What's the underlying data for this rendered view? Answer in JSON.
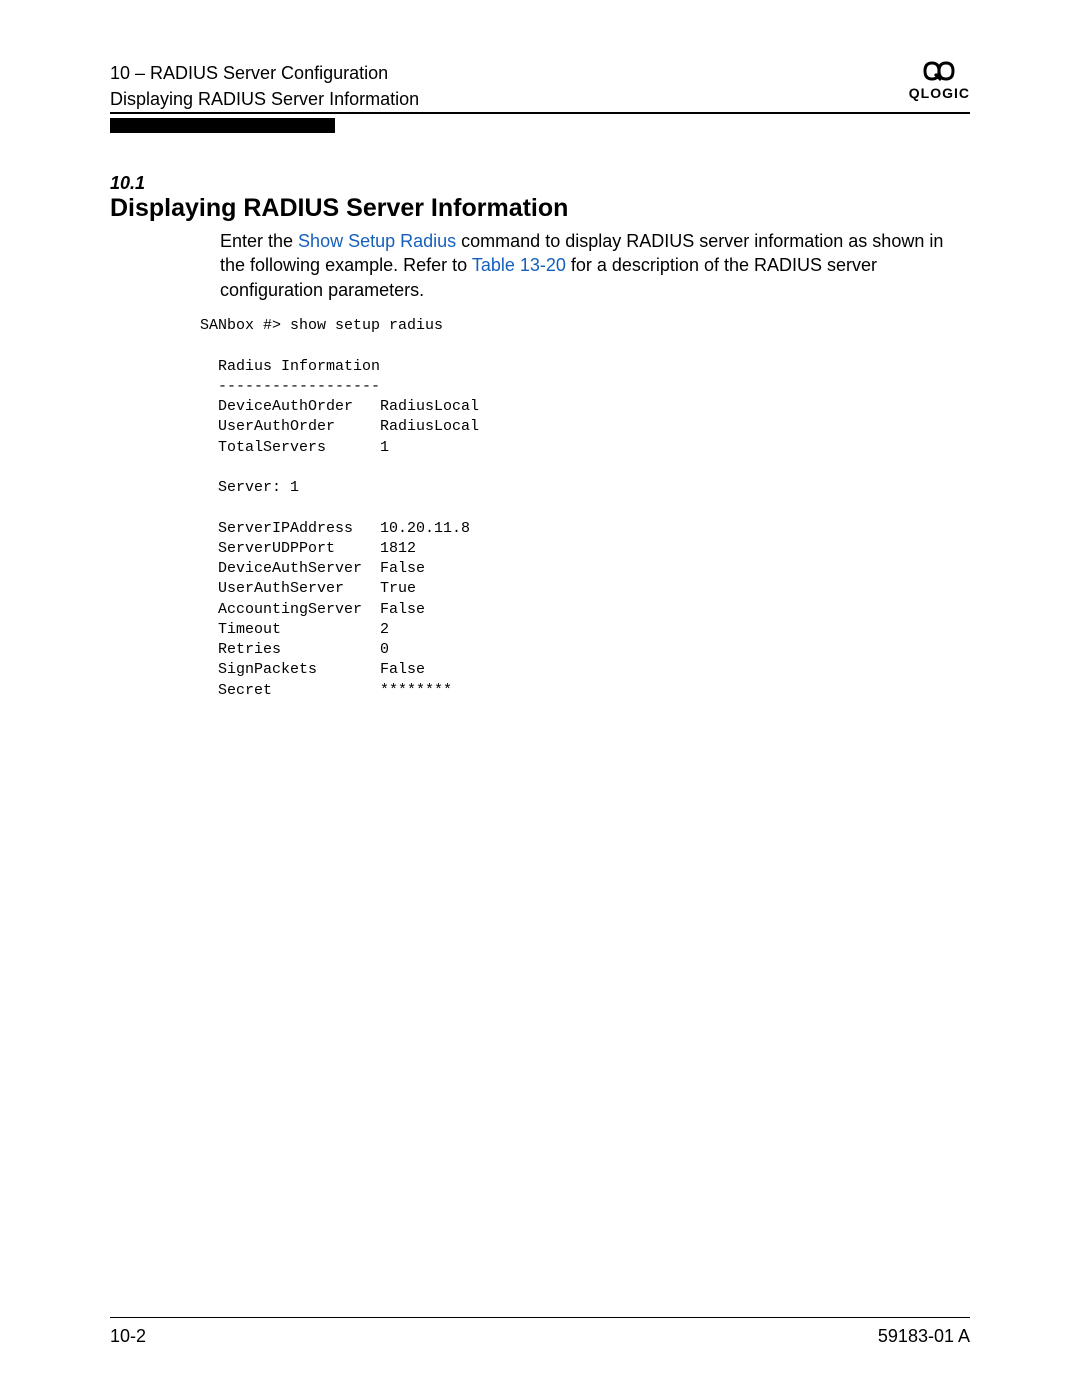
{
  "header": {
    "line1": "10 – RADIUS Server Configuration",
    "line2": "Displaying RADIUS Server Information",
    "logo_text": "QLOGIC"
  },
  "section": {
    "number": "10.1",
    "title": "Displaying RADIUS Server Information"
  },
  "body": {
    "p1_part1": "Enter the ",
    "p1_link1": "Show Setup Radius",
    "p1_part2": " command to display RADIUS server information as shown in the following example. Refer to ",
    "p1_link2": "Table 13-20",
    "p1_part3": " for a description of the RADIUS server configuration parameters."
  },
  "code": {
    "prompt": "SANbox #> show setup radius",
    "heading": "  Radius Information",
    "divider": "  ------------------",
    "rows1": [
      {
        "k": "  DeviceAuthOrder",
        "v": "RadiusLocal"
      },
      {
        "k": "  UserAuthOrder",
        "v": "RadiusLocal"
      },
      {
        "k": "  TotalServers",
        "v": "1"
      }
    ],
    "server_line": "  Server: 1",
    "rows2": [
      {
        "k": "  ServerIPAddress",
        "v": "10.20.11.8"
      },
      {
        "k": "  ServerUDPPort",
        "v": "1812"
      },
      {
        "k": "  DeviceAuthServer",
        "v": "False"
      },
      {
        "k": "  UserAuthServer",
        "v": "True"
      },
      {
        "k": "  AccountingServer",
        "v": "False"
      },
      {
        "k": "  Timeout",
        "v": "2"
      },
      {
        "k": "  Retries",
        "v": "0"
      },
      {
        "k": "  SignPackets",
        "v": "False"
      },
      {
        "k": "  Secret",
        "v": "********"
      }
    ]
  },
  "footer": {
    "page": "10-2",
    "docnum": "59183-01 A"
  }
}
